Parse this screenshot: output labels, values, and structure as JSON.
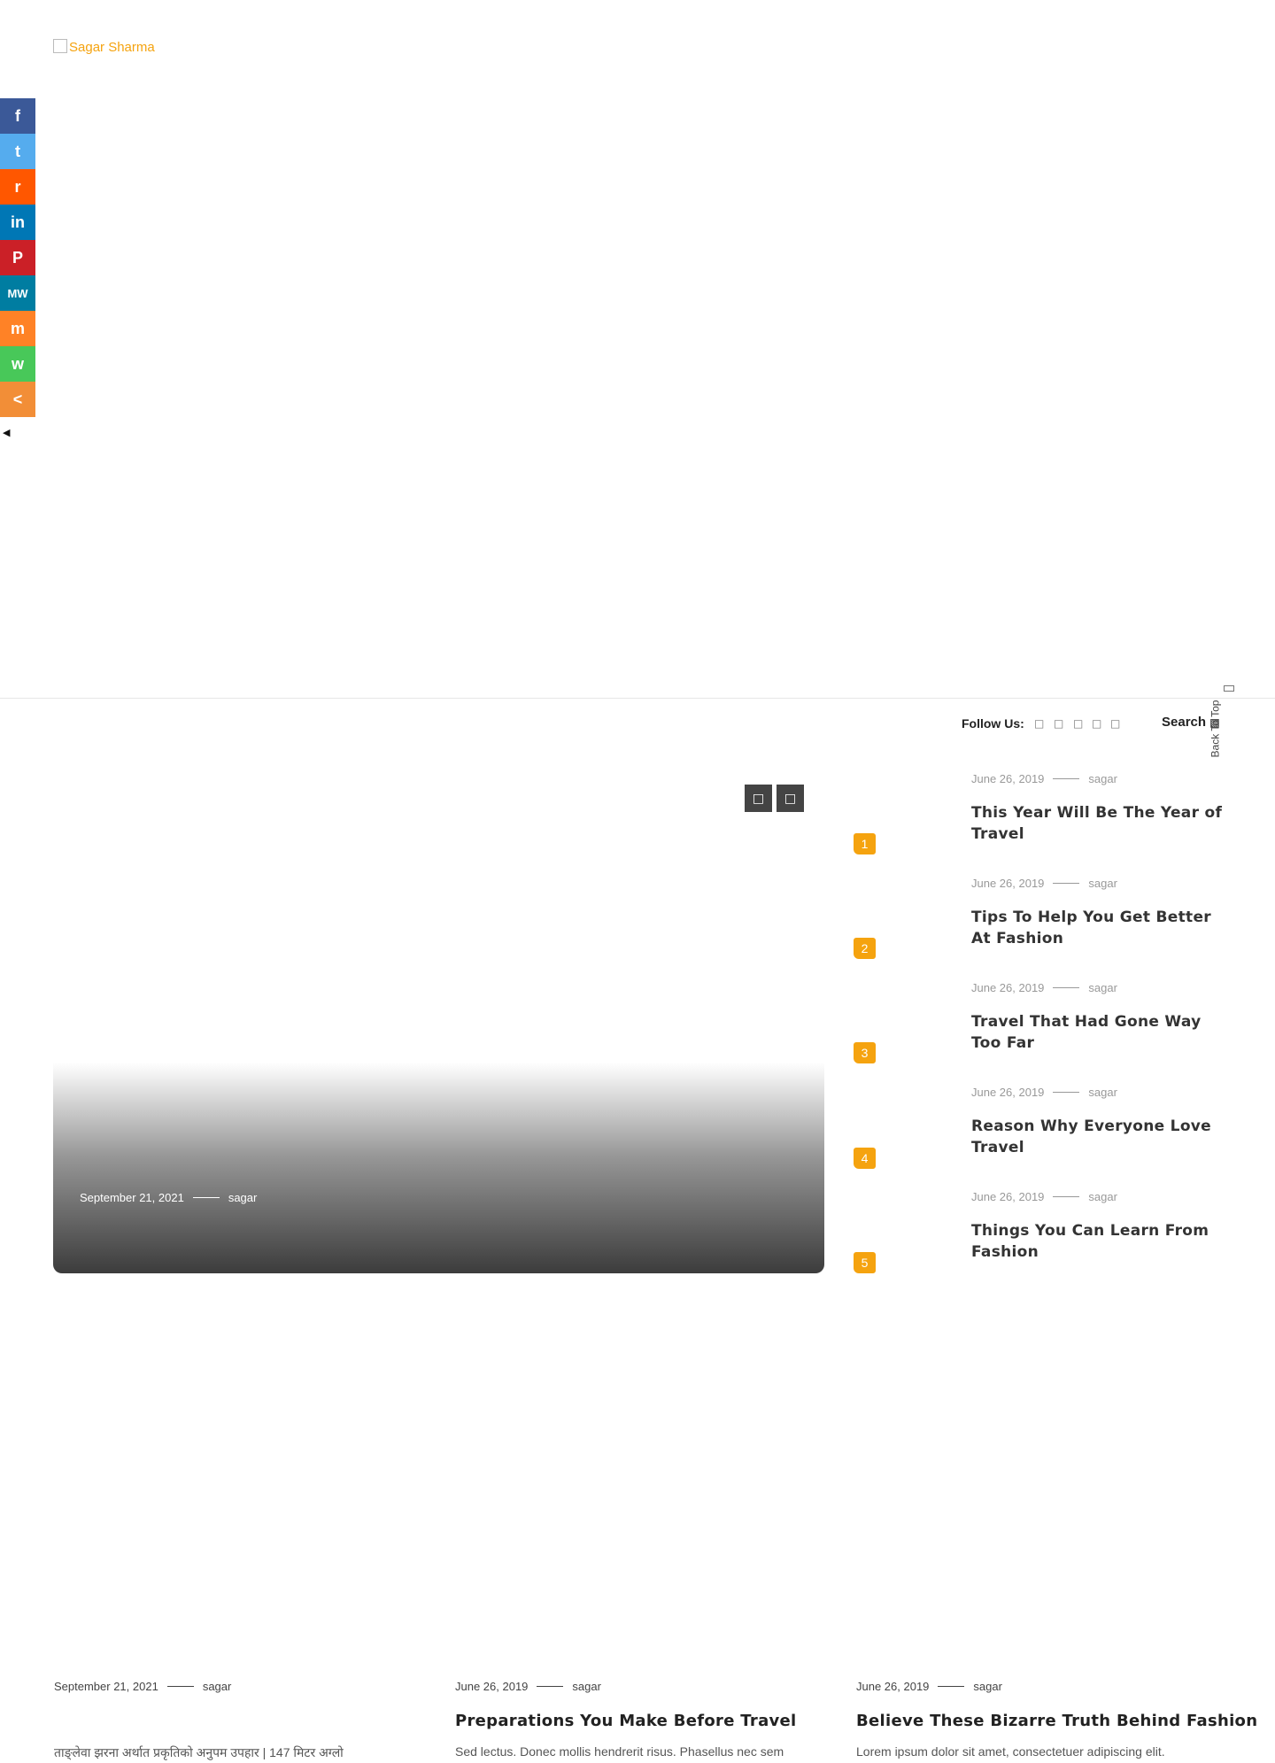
{
  "site": {
    "logo_alt": "Sagar Sharma"
  },
  "share_bar": {
    "buttons": [
      {
        "name": "facebook",
        "glyph": "f",
        "color": "#3b5998"
      },
      {
        "name": "twitter",
        "glyph": "t",
        "color": "#55acee"
      },
      {
        "name": "reddit",
        "glyph": "r",
        "color": "#ff5700"
      },
      {
        "name": "linkedin",
        "glyph": "in",
        "color": "#0077b5"
      },
      {
        "name": "pinterest",
        "glyph": "P",
        "color": "#cb2027"
      },
      {
        "name": "mewe",
        "glyph": "MW",
        "color": "#007da1"
      },
      {
        "name": "mix",
        "glyph": "m",
        "color": "#ff8226"
      },
      {
        "name": "whatsapp",
        "glyph": "w",
        "color": "#48c859"
      },
      {
        "name": "more",
        "glyph": "<",
        "color": "#f28e37"
      }
    ],
    "hide_icon": "hide-share-icon"
  },
  "header": {
    "follow_label": "Follow Us:",
    "social_icons": [
      "facebook-icon",
      "twitter-icon",
      "instagram-icon",
      "pinterest-icon",
      "youtube-icon"
    ],
    "search_label": "Search",
    "back_to_top": "Back To Top"
  },
  "hero": {
    "date": "September 21, 2021",
    "author": "sagar",
    "prev_icon": "chevron-left-icon",
    "next_icon": "chevron-right-icon"
  },
  "trending": [
    {
      "num": "1",
      "date": "June 26, 2019",
      "author": "sagar",
      "title": "This Year Will Be The Year of Travel"
    },
    {
      "num": "2",
      "date": "June 26, 2019",
      "author": "sagar",
      "title": "Tips To Help You Get Better At Fashion"
    },
    {
      "num": "3",
      "date": "June 26, 2019",
      "author": "sagar",
      "title": "Travel That Had Gone Way Too Far"
    },
    {
      "num": "4",
      "date": "June 26, 2019",
      "author": "sagar",
      "title": "Reason Why Everyone Love Travel"
    },
    {
      "num": "5",
      "date": "June 26, 2019",
      "author": "sagar",
      "title": "Things You Can Learn From Fashion"
    }
  ],
  "posts": [
    {
      "date": "September 21, 2021",
      "author": "sagar",
      "title": "",
      "excerpt": "ताङ्लेवा झरना अर्थात प्रकृतिको अनुपम उपहार | 147 मिटर अग्लो"
    },
    {
      "date": "June 26, 2019",
      "author": "sagar",
      "title": "Preparations You Make Before Travel",
      "excerpt": "Sed lectus. Donec mollis hendrerit risus. Phasellus nec sem"
    },
    {
      "date": "June 26, 2019",
      "author": "sagar",
      "title": "Believe These Bizarre Truth Behind Fashion",
      "excerpt": "Lorem ipsum dolor sit amet, consectetuer adipiscing elit."
    }
  ]
}
